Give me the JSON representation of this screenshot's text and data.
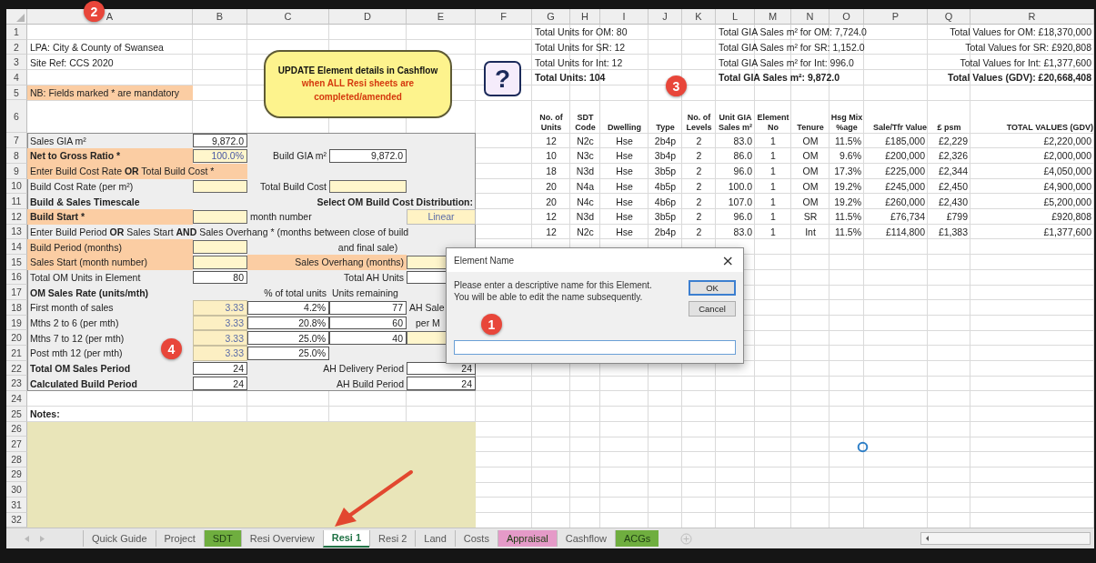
{
  "columns": [
    "A",
    "B",
    "C",
    "D",
    "E",
    "F",
    "G",
    "H",
    "I",
    "J",
    "K",
    "L",
    "M",
    "N",
    "O",
    "P",
    "Q",
    "R"
  ],
  "rows": [
    {
      "number": "1",
      "cells": {
        "G": {
          "kind": "text",
          "text": "Total Units for OM: 80"
        },
        "L": {
          "kind": "text",
          "text": "Total GIA Sales m² for OM: 7,724.0"
        },
        "R": {
          "kind": "text_right",
          "text": "Total Values for OM: £18,370,000"
        }
      }
    },
    {
      "number": "2",
      "cells": {
        "A": {
          "kind": "text",
          "text": "LPA: City & County of Swansea"
        },
        "G": {
          "kind": "text",
          "text": "Total Units for SR: 12"
        },
        "L": {
          "kind": "text",
          "text": "Total GIA Sales m² for SR: 1,152.0"
        },
        "R": {
          "kind": "text_right",
          "text": "Total Values for SR: £920,808"
        }
      }
    },
    {
      "number": "3",
      "cells": {
        "A": {
          "kind": "text",
          "text": "Site Ref: CCS 2020"
        },
        "G": {
          "kind": "text",
          "text": "Total Units for Int: 12"
        },
        "L": {
          "kind": "text",
          "text": "Total GIA Sales m² for Int: 996.0"
        },
        "R": {
          "kind": "text_right",
          "text": "Total Values for Int: £1,377,600"
        }
      }
    },
    {
      "number": "4",
      "cells": {
        "G": {
          "kind": "bold",
          "text": "Total Units: 104"
        },
        "L": {
          "kind": "bold",
          "text": "Total GIA Sales m²: 9,872.0"
        },
        "R": {
          "kind": "bold_right",
          "text": "Total Values (GDV): £20,668,408"
        }
      }
    },
    {
      "number": "5",
      "cells": {
        "A": {
          "kind": "mandatory",
          "text": "NB: Fields marked * are mandatory"
        }
      }
    },
    {
      "number": "6",
      "cells": {
        "G": {
          "kind": "header",
          "text": "No. of Units"
        },
        "H": {
          "kind": "header",
          "text": "SDT Code"
        },
        "I": {
          "kind": "header",
          "text": "Dwelling"
        },
        "J": {
          "kind": "header",
          "text": "Type"
        },
        "K": {
          "kind": "header",
          "text": "No. of Levels"
        },
        "L": {
          "kind": "header",
          "text": "Unit GIA Sales m²"
        },
        "M": {
          "kind": "header",
          "text": "Element No"
        },
        "N": {
          "kind": "header",
          "text": "Tenure"
        },
        "O": {
          "kind": "header",
          "text": "Hsg Mix %age"
        },
        "P": {
          "kind": "header_right",
          "text": "Sale/Tfr Value"
        },
        "Q": {
          "kind": "header",
          "text": "£ psm"
        },
        "R": {
          "kind": "header_right",
          "text": "TOTAL VALUES (GDV)"
        }
      }
    },
    {
      "number": "7",
      "cells": {
        "A": {
          "kind": "text",
          "text": "Sales GIA m²"
        },
        "B": {
          "kind": "box",
          "text": "9,872.0"
        },
        "G": {
          "kind": "center",
          "text": "12"
        },
        "H": {
          "kind": "center",
          "text": "N2c"
        },
        "I": {
          "kind": "center",
          "text": "Hse"
        },
        "J": {
          "kind": "center",
          "text": "2b4p"
        },
        "K": {
          "kind": "center",
          "text": "2"
        },
        "L": {
          "kind": "num",
          "text": "83.0"
        },
        "M": {
          "kind": "center",
          "text": "1"
        },
        "N": {
          "kind": "center",
          "text": "OM"
        },
        "O": {
          "kind": "num",
          "text": "11.5%"
        },
        "P": {
          "kind": "num",
          "text": "£185,000"
        },
        "Q": {
          "kind": "num",
          "text": "£2,229"
        },
        "R": {
          "kind": "num",
          "text": "£2,220,000"
        }
      }
    },
    {
      "number": "8",
      "cells": {
        "A": {
          "kind": "mandatory_bold",
          "text": "Net to Gross Ratio *"
        },
        "B": {
          "kind": "input",
          "text": "100.0%"
        },
        "C": {
          "kind": "text_right",
          "text": "Build GIA m²"
        },
        "D": {
          "kind": "box",
          "text": "9,872.0"
        },
        "G": {
          "kind": "center",
          "text": "10"
        },
        "H": {
          "kind": "center",
          "text": "N3c"
        },
        "I": {
          "kind": "center",
          "text": "Hse"
        },
        "J": {
          "kind": "center",
          "text": "3b4p"
        },
        "K": {
          "kind": "center",
          "text": "2"
        },
        "L": {
          "kind": "num",
          "text": "86.0"
        },
        "M": {
          "kind": "center",
          "text": "1"
        },
        "N": {
          "kind": "center",
          "text": "OM"
        },
        "O": {
          "kind": "num",
          "text": "9.6%"
        },
        "P": {
          "kind": "num",
          "text": "£200,000"
        },
        "Q": {
          "kind": "num",
          "text": "£2,326"
        },
        "R": {
          "kind": "num",
          "text": "£2,000,000"
        }
      }
    },
    {
      "number": "9",
      "cells": {
        "A": {
          "kind": "mandatory",
          "text": "Enter Build Cost Rate **OR** Total Build Cost *"
        },
        "B": {
          "kind": "mandatory"
        },
        "G": {
          "kind": "center",
          "text": "18"
        },
        "H": {
          "kind": "center",
          "text": "N3d"
        },
        "I": {
          "kind": "center",
          "text": "Hse"
        },
        "J": {
          "kind": "center",
          "text": "3b5p"
        },
        "K": {
          "kind": "center",
          "text": "2"
        },
        "L": {
          "kind": "num",
          "text": "96.0"
        },
        "M": {
          "kind": "center",
          "text": "1"
        },
        "N": {
          "kind": "center",
          "text": "OM"
        },
        "O": {
          "kind": "num",
          "text": "17.3%"
        },
        "P": {
          "kind": "num",
          "text": "£225,000"
        },
        "Q": {
          "kind": "num",
          "text": "£2,344"
        },
        "R": {
          "kind": "num",
          "text": "£4,050,000"
        }
      }
    },
    {
      "number": "10",
      "cells": {
        "A": {
          "kind": "text",
          "text": "Build Cost Rate (per m²)"
        },
        "B": {
          "kind": "input"
        },
        "C": {
          "kind": "text_right",
          "text": "Total Build Cost"
        },
        "D": {
          "kind": "input"
        },
        "G": {
          "kind": "center",
          "text": "20"
        },
        "H": {
          "kind": "center",
          "text": "N4a"
        },
        "I": {
          "kind": "center",
          "text": "Hse"
        },
        "J": {
          "kind": "center",
          "text": "4b5p"
        },
        "K": {
          "kind": "center",
          "text": "2"
        },
        "L": {
          "kind": "num",
          "text": "100.0"
        },
        "M": {
          "kind": "center",
          "text": "1"
        },
        "N": {
          "kind": "center",
          "text": "OM"
        },
        "O": {
          "kind": "num",
          "text": "19.2%"
        },
        "P": {
          "kind": "num",
          "text": "£245,000"
        },
        "Q": {
          "kind": "num",
          "text": "£2,450"
        },
        "R": {
          "kind": "num",
          "text": "£4,900,000"
        }
      }
    },
    {
      "number": "11",
      "cells": {
        "A": {
          "kind": "bold",
          "text": "Build & Sales Timescale"
        },
        "E": {
          "kind": "bold_right",
          "text": "Select OM Build Cost Distribution:"
        },
        "G": {
          "kind": "center",
          "text": "20"
        },
        "H": {
          "kind": "center",
          "text": "N4c"
        },
        "I": {
          "kind": "center",
          "text": "Hse"
        },
        "J": {
          "kind": "center",
          "text": "4b6p"
        },
        "K": {
          "kind": "center",
          "text": "2"
        },
        "L": {
          "kind": "num",
          "text": "107.0"
        },
        "M": {
          "kind": "center",
          "text": "1"
        },
        "N": {
          "kind": "center",
          "text": "OM"
        },
        "O": {
          "kind": "num",
          "text": "19.2%"
        },
        "P": {
          "kind": "num",
          "text": "£260,000"
        },
        "Q": {
          "kind": "num",
          "text": "£2,430"
        },
        "R": {
          "kind": "num",
          "text": "£5,200,000"
        }
      }
    },
    {
      "number": "12",
      "cells": {
        "A": {
          "kind": "mandatory_bold",
          "text": "Build Start *"
        },
        "B": {
          "kind": "input"
        },
        "C": {
          "kind": "text",
          "text": "month number"
        },
        "E": {
          "kind": "select",
          "text": "Linear"
        },
        "G": {
          "kind": "center",
          "text": "12"
        },
        "H": {
          "kind": "center",
          "text": "N3d"
        },
        "I": {
          "kind": "center",
          "text": "Hse"
        },
        "J": {
          "kind": "center",
          "text": "3b5p"
        },
        "K": {
          "kind": "center",
          "text": "2"
        },
        "L": {
          "kind": "num",
          "text": "96.0"
        },
        "M": {
          "kind": "center",
          "text": "1"
        },
        "N": {
          "kind": "center",
          "text": "SR"
        },
        "O": {
          "kind": "num",
          "text": "11.5%"
        },
        "P": {
          "kind": "num",
          "text": "£76,734"
        },
        "Q": {
          "kind": "num",
          "text": "£799"
        },
        "R": {
          "kind": "num",
          "text": "£920,808"
        }
      }
    },
    {
      "number": "13",
      "cells": {
        "A": {
          "kind": "text",
          "text": "Enter Build Period **OR** Sales Start **AND** Sales Overhang * (months between close of build"
        },
        "G": {
          "kind": "center",
          "text": "12"
        },
        "H": {
          "kind": "center",
          "text": "N2c"
        },
        "I": {
          "kind": "center",
          "text": "Hse"
        },
        "J": {
          "kind": "center",
          "text": "2b4p"
        },
        "K": {
          "kind": "center",
          "text": "2"
        },
        "L": {
          "kind": "num",
          "text": "83.0"
        },
        "M": {
          "kind": "center",
          "text": "1"
        },
        "N": {
          "kind": "center",
          "text": "Int"
        },
        "O": {
          "kind": "num",
          "text": "11.5%"
        },
        "P": {
          "kind": "num",
          "text": "£114,800"
        },
        "Q": {
          "kind": "num",
          "text": "£1,383"
        },
        "R": {
          "kind": "num",
          "text": "£1,377,600"
        }
      }
    },
    {
      "number": "14",
      "cells": {
        "A": {
          "kind": "mandatory",
          "text": "Build Period (months)"
        },
        "B": {
          "kind": "input"
        },
        "D": {
          "kind": "text_center",
          "text": "and final sale)"
        }
      }
    },
    {
      "number": "15",
      "cells": {
        "A": {
          "kind": "mandatory",
          "text": "Sales Start (month number)"
        },
        "B": {
          "kind": "input"
        },
        "C": {
          "kind": "mandatory"
        },
        "D": {
          "kind": "mandatory_right",
          "text": "Sales Overhang (months)"
        },
        "E": {
          "kind": "input"
        }
      }
    },
    {
      "number": "16",
      "cells": {
        "A": {
          "kind": "text",
          "text": "Total OM Units in Element"
        },
        "B": {
          "kind": "box",
          "text": "80"
        },
        "D": {
          "kind": "text_right",
          "text": "Total AH Units"
        },
        "E": {
          "kind": "box"
        }
      }
    },
    {
      "number": "17",
      "cells": {
        "A": {
          "kind": "bold",
          "text": "OM Sales Rate (units/mth)"
        },
        "C": {
          "kind": "text_right",
          "text": "% of total units"
        },
        "D": {
          "kind": "text",
          "text": "Units remaining"
        }
      }
    },
    {
      "number": "18",
      "cells": {
        "A": {
          "kind": "text",
          "text": "First month of sales"
        },
        "B": {
          "kind": "field",
          "text": "3.33"
        },
        "C": {
          "kind": "box",
          "text": "4.2%"
        },
        "D": {
          "kind": "box",
          "text": "77"
        },
        "E": {
          "kind": "text",
          "text": "AH Sale"
        }
      }
    },
    {
      "number": "19",
      "cells": {
        "A": {
          "kind": "text",
          "text": "Mths 2 to 6 (per mth)"
        },
        "B": {
          "kind": "field",
          "text": "3.33"
        },
        "C": {
          "kind": "box",
          "text": "20.8%"
        },
        "D": {
          "kind": "box",
          "text": "60"
        },
        "E": {
          "kind": "text_indent",
          "text": "per M"
        }
      }
    },
    {
      "number": "20",
      "cells": {
        "A": {
          "kind": "text",
          "text": "Mths 7 to 12 (per mth)"
        },
        "B": {
          "kind": "field",
          "text": "3.33"
        },
        "C": {
          "kind": "box",
          "text": "25.0%"
        },
        "D": {
          "kind": "box",
          "text": "40"
        },
        "E": {
          "kind": "input"
        }
      }
    },
    {
      "number": "21",
      "cells": {
        "A": {
          "kind": "text",
          "text": "Post mth 12 (per mth)"
        },
        "B": {
          "kind": "field",
          "text": "3.33"
        },
        "C": {
          "kind": "box",
          "text": "25.0%"
        }
      }
    },
    {
      "number": "22",
      "cells": {
        "A": {
          "kind": "bold",
          "text": "Total OM Sales Period"
        },
        "B": {
          "kind": "box",
          "text": "24"
        },
        "D": {
          "kind": "text_right",
          "text": "AH Delivery Period"
        },
        "E": {
          "kind": "box",
          "text": "24"
        }
      }
    },
    {
      "number": "23",
      "cells": {
        "A": {
          "kind": "bold",
          "text": "Calculated Build Period"
        },
        "B": {
          "kind": "box",
          "text": "24"
        },
        "D": {
          "kind": "text_right",
          "text": "AH Build Period"
        },
        "E": {
          "kind": "box",
          "text": "24"
        }
      }
    },
    {
      "number": "24",
      "cells": {}
    },
    {
      "number": "25",
      "cells": {
        "A": {
          "kind": "bold",
          "text": "Notes:"
        }
      }
    },
    {
      "number": "26",
      "cells": {}
    },
    {
      "number": "27",
      "cells": {}
    },
    {
      "number": "28",
      "cells": {}
    },
    {
      "number": "29",
      "cells": {}
    },
    {
      "number": "30",
      "cells": {}
    },
    {
      "number": "31",
      "cells": {}
    },
    {
      "number": "32",
      "cells": {}
    }
  ],
  "note": {
    "text": "UPDATE Element details in Cashflow",
    "highlight": "when ALL Resi sheets are completed/amended"
  },
  "help_button": {
    "label": "?"
  },
  "callouts": [
    {
      "label": "2"
    },
    {
      "label": "3"
    },
    {
      "label": "1"
    },
    {
      "label": "4"
    }
  ],
  "dialog": {
    "title": "Element Name",
    "close": "×",
    "message_lines": [
      "Please enter a descriptive name for this Element.",
      "You will be able to edit the name subsequently."
    ],
    "buttons": [
      {
        "label": "OK",
        "default": true
      },
      {
        "label": "Cancel",
        "default": false
      }
    ]
  },
  "tabs": [
    {
      "label": "Quick Guide",
      "selected": false
    },
    {
      "label": "Project",
      "selected": false
    },
    {
      "label": "SDT",
      "selected": false,
      "color": "#6fae3f"
    },
    {
      "label": "Resi Overview",
      "selected": false
    },
    {
      "label": "Resi 1",
      "selected": true
    },
    {
      "label": "Resi 2",
      "selected": false
    },
    {
      "label": "Land",
      "selected": false
    },
    {
      "label": "Costs",
      "selected": false
    },
    {
      "label": "Appraisal",
      "selected": false,
      "color": "#e59ac8"
    },
    {
      "label": "Cashflow",
      "selected": false
    },
    {
      "label": "ACGs",
      "selected": false,
      "color": "#6fae3f"
    }
  ]
}
